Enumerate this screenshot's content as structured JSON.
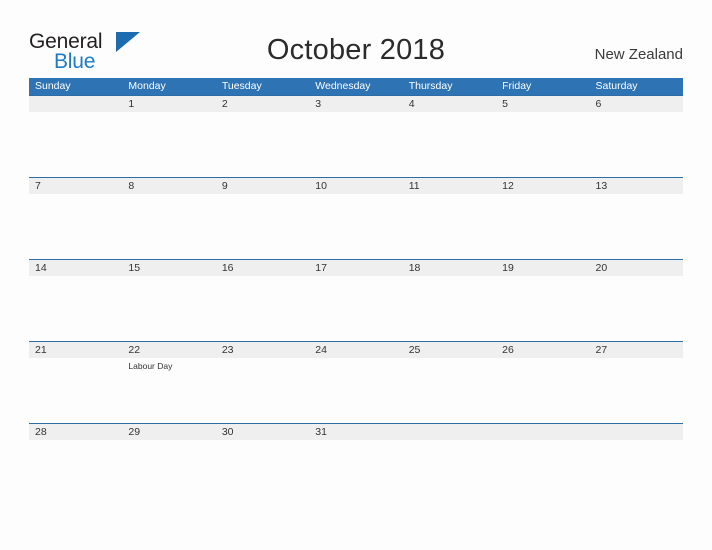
{
  "brand": {
    "name_part1": "General",
    "name_part2": "Blue",
    "triangle_color": "#1d6cb0",
    "blue_text_color": "#1e7bc4"
  },
  "header": {
    "title": "October 2018",
    "region": "New Zealand"
  },
  "colors": {
    "header_blue": "#2e74b5",
    "row_divider_blue": "#2e6da4",
    "number_band_gray": "#efefef",
    "page_background": "#fdfdfd",
    "text_dark": "#333333"
  },
  "calendar": {
    "weekdays": [
      "Sunday",
      "Monday",
      "Tuesday",
      "Wednesday",
      "Thursday",
      "Friday",
      "Saturday"
    ],
    "weeks": [
      {
        "days": [
          {
            "number": "",
            "event": ""
          },
          {
            "number": "1",
            "event": ""
          },
          {
            "number": "2",
            "event": ""
          },
          {
            "number": "3",
            "event": ""
          },
          {
            "number": "4",
            "event": ""
          },
          {
            "number": "5",
            "event": ""
          },
          {
            "number": "6",
            "event": ""
          }
        ]
      },
      {
        "days": [
          {
            "number": "7",
            "event": ""
          },
          {
            "number": "8",
            "event": ""
          },
          {
            "number": "9",
            "event": ""
          },
          {
            "number": "10",
            "event": ""
          },
          {
            "number": "11",
            "event": ""
          },
          {
            "number": "12",
            "event": ""
          },
          {
            "number": "13",
            "event": ""
          }
        ]
      },
      {
        "days": [
          {
            "number": "14",
            "event": ""
          },
          {
            "number": "15",
            "event": ""
          },
          {
            "number": "16",
            "event": ""
          },
          {
            "number": "17",
            "event": ""
          },
          {
            "number": "18",
            "event": ""
          },
          {
            "number": "19",
            "event": ""
          },
          {
            "number": "20",
            "event": ""
          }
        ]
      },
      {
        "days": [
          {
            "number": "21",
            "event": ""
          },
          {
            "number": "22",
            "event": "Labour Day"
          },
          {
            "number": "23",
            "event": ""
          },
          {
            "number": "24",
            "event": ""
          },
          {
            "number": "25",
            "event": ""
          },
          {
            "number": "26",
            "event": ""
          },
          {
            "number": "27",
            "event": ""
          }
        ]
      },
      {
        "days": [
          {
            "number": "28",
            "event": ""
          },
          {
            "number": "29",
            "event": ""
          },
          {
            "number": "30",
            "event": ""
          },
          {
            "number": "31",
            "event": ""
          },
          {
            "number": "",
            "event": ""
          },
          {
            "number": "",
            "event": ""
          },
          {
            "number": "",
            "event": ""
          }
        ]
      }
    ]
  }
}
